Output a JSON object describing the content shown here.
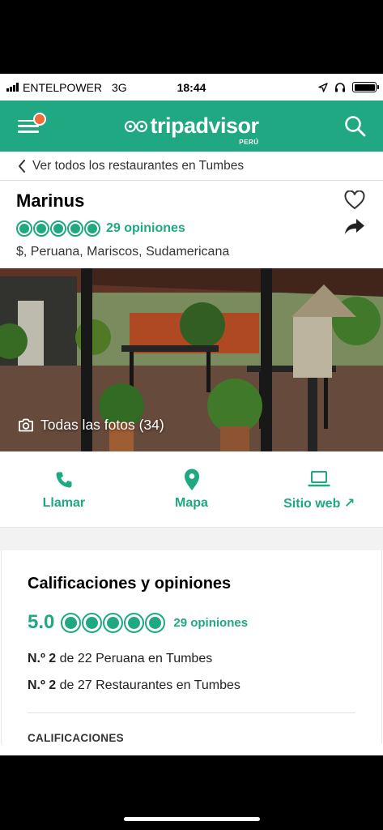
{
  "status_bar": {
    "carrier": "ENTELPOWER",
    "network": "3G",
    "time": "18:44",
    "icons": [
      "location-arrow-icon",
      "headphones-icon",
      "battery-icon"
    ]
  },
  "app_bar": {
    "logo_text": "tripadvisor",
    "logo_sub": "PERÚ",
    "menu_icon": "hamburger-icon",
    "search_icon": "search-icon",
    "accent_color": "#1fa882",
    "notification_color": "#f26b3a"
  },
  "back_link": {
    "label": "Ver todos los restaurantes en Tumbes"
  },
  "restaurant": {
    "name": "Marinus",
    "bubble_rating": 5,
    "review_count_label": "29 opiniones",
    "cuisine": "$, Peruana, Mariscos, Sudamericana"
  },
  "photo": {
    "caption": "Todas las fotos (34)"
  },
  "actions": [
    {
      "label": "Llamar",
      "icon": "phone-icon"
    },
    {
      "label": "Mapa",
      "icon": "map-pin-icon"
    },
    {
      "label": "Sitio web",
      "suffix": "↗",
      "icon": "laptop-icon"
    }
  ],
  "ratings": {
    "title": "Calificaciones y opiniones",
    "score": "5.0",
    "review_count_label": "29 opiniones",
    "ranks": [
      {
        "prefix": "N.º 2",
        "text": " de 22 Peruana en Tumbes"
      },
      {
        "prefix": "N.º 2",
        "text": " de 27 Restaurantes en Tumbes"
      }
    ],
    "section_label": "CALIFICACIONES"
  }
}
